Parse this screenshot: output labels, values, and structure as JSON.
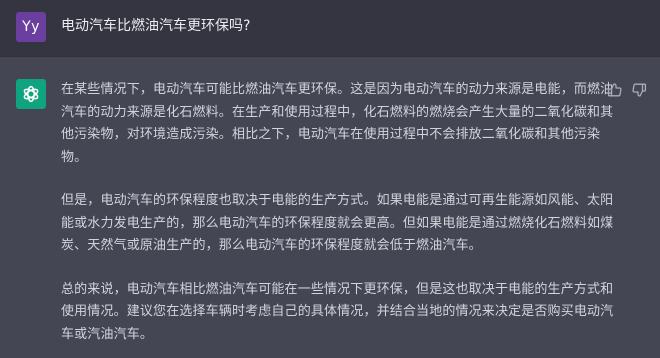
{
  "user": {
    "avatar_initials": "Yy",
    "message": "电动汽车比燃油汽车更环保吗?"
  },
  "assistant": {
    "paragraphs": [
      "在某些情况下，电动汽车可能比燃油汽车更环保。这是因为电动汽车的动力来源是电能，而燃油汽车的动力来源是化石燃料。在生产和使用过程中，化石燃料的燃烧会产生大量的二氧化碳和其他污染物，对环境造成污染。相比之下，电动汽车在使用过程中不会排放二氧化碳和其他污染物。",
      "但是，电动汽车的环保程度也取决于电能的生产方式。如果电能是通过可再生能源如风能、太阳能或水力发电生产的，那么电动汽车的环保程度就会更高。但如果电能是通过燃烧化石燃料如煤炭、天然气或原油生产的，那么电动汽车的环保程度就会低于燃油汽车。",
      "总的来说，电动汽车相比燃油汽车可能在一些情况下更环保，但是这也取决于电能的生产方式和使用情况。建议您在选择车辆时考虑自己的具体情况，并结合当地的情况来决定是否购买电动汽车或汽油汽车。"
    ]
  },
  "icons": {
    "user_avatar_color": "#6b3fa0",
    "assistant_avatar_color": "#10a37f",
    "assistant_avatar": "openai-logo-icon",
    "feedback_up": "thumbs-up-icon",
    "feedback_down": "thumbs-down-icon"
  }
}
